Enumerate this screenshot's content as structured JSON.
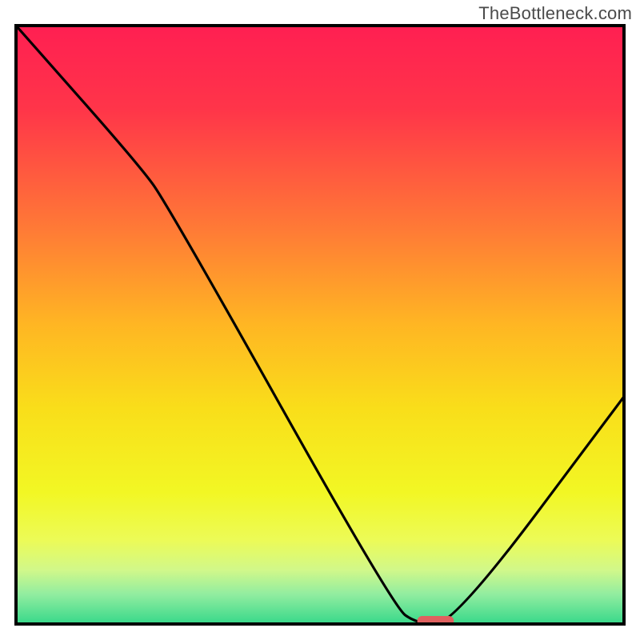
{
  "watermark": "TheBottleneck.com",
  "chart_data": {
    "type": "line",
    "title": "",
    "xlabel": "",
    "ylabel": "",
    "xlim": [
      0,
      100
    ],
    "ylim": [
      0,
      100
    ],
    "grid": false,
    "legend": false,
    "series": [
      {
        "name": "bottleneck-curve",
        "x": [
          0,
          20,
          25,
          62,
          66,
          72,
          100
        ],
        "y": [
          100,
          77,
          70,
          3,
          0,
          0,
          38
        ]
      }
    ],
    "marker": {
      "name": "optimal-range",
      "x_start": 66,
      "x_end": 72,
      "y": 0,
      "color": "#e0615f"
    },
    "gradient_stops": [
      {
        "pos": 0.0,
        "color": "#ff1f52"
      },
      {
        "pos": 0.14,
        "color": "#ff3549"
      },
      {
        "pos": 0.34,
        "color": "#ff7a36"
      },
      {
        "pos": 0.5,
        "color": "#ffb623"
      },
      {
        "pos": 0.64,
        "color": "#f9de1a"
      },
      {
        "pos": 0.78,
        "color": "#f2f724"
      },
      {
        "pos": 0.86,
        "color": "#ecfb57"
      },
      {
        "pos": 0.91,
        "color": "#d1f88a"
      },
      {
        "pos": 0.95,
        "color": "#92eda0"
      },
      {
        "pos": 1.0,
        "color": "#37d88a"
      }
    ],
    "frame_color": "#000000",
    "curve_color": "#000000"
  }
}
